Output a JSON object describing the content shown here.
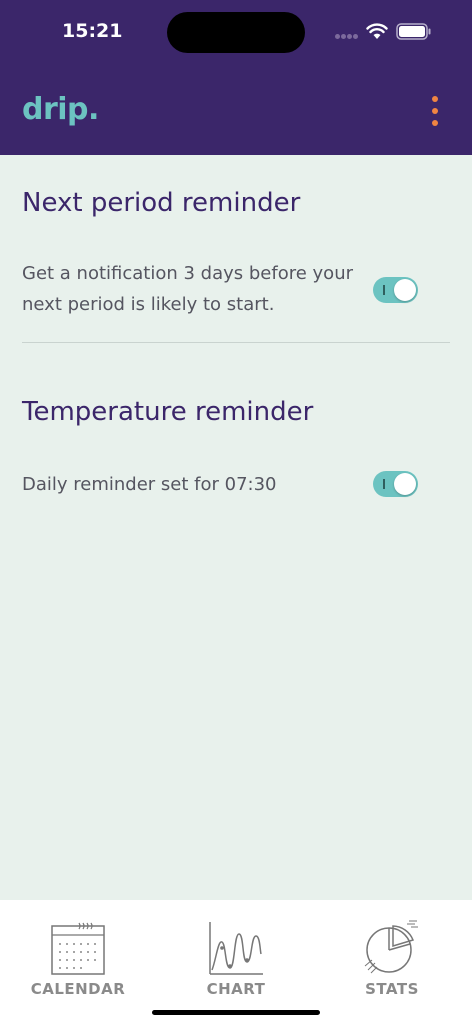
{
  "status_bar": {
    "time": "15:21"
  },
  "header": {
    "brand": "drip.",
    "menu_icon": "vertical-ellipsis-icon"
  },
  "sections": [
    {
      "title": "Next period reminder",
      "text": "Get a notification 3 days before your next period is likely to start.",
      "toggle_on": true
    },
    {
      "title": "Temperature reminder",
      "text": "Daily reminder set for 07:30",
      "toggle_on": true
    }
  ],
  "tabs": [
    {
      "label": "CALENDAR",
      "icon": "calendar-icon"
    },
    {
      "label": "CHART",
      "icon": "line-chart-icon"
    },
    {
      "label": "STATS",
      "icon": "pie-chart-icon"
    }
  ],
  "colors": {
    "header_bg": "#3b266a",
    "brand": "#6cc3c1",
    "accent_menu": "#f08542",
    "page_bg": "#e8f1ec",
    "title_text": "#3b266a",
    "toggle_on": "#6cc3c1"
  }
}
